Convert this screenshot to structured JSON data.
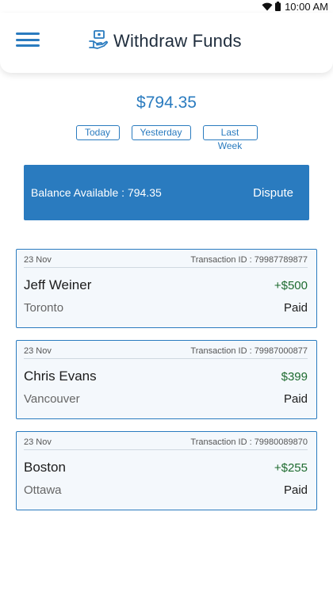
{
  "status_bar": {
    "time": "10:00 AM",
    "wifi_icon": "wifi-icon",
    "battery_icon": "battery-icon"
  },
  "header": {
    "title": "Withdraw Funds",
    "menu_icon": "hamburger-menu-icon",
    "title_icon": "hand-money-icon"
  },
  "summary": {
    "amount": "$794.35",
    "filters": [
      "Today",
      "Yesterday",
      "Last Week"
    ]
  },
  "balance": {
    "label": "Balance Available : 794.35",
    "dispute_label": "Dispute"
  },
  "transactions": [
    {
      "date": "23 Nov",
      "id": "Transaction ID : 79987789877",
      "name": "Jeff Weiner",
      "amount": "+$500",
      "city": "Toronto",
      "status": "Paid"
    },
    {
      "date": "23 Nov",
      "id": "Transaction ID : 79987000877",
      "name": "Chris Evans",
      "amount": "$399",
      "city": "Vancouver",
      "status": "Paid"
    },
    {
      "date": "23 Nov",
      "id": "Transaction ID : 79980089870",
      "name": "Boston",
      "amount": "+$255",
      "city": "Ottawa",
      "status": "Paid"
    }
  ],
  "colors": {
    "accent": "#2a7bbf",
    "amount_green": "#1e6b2f",
    "card_bg": "#f4f8fc"
  }
}
